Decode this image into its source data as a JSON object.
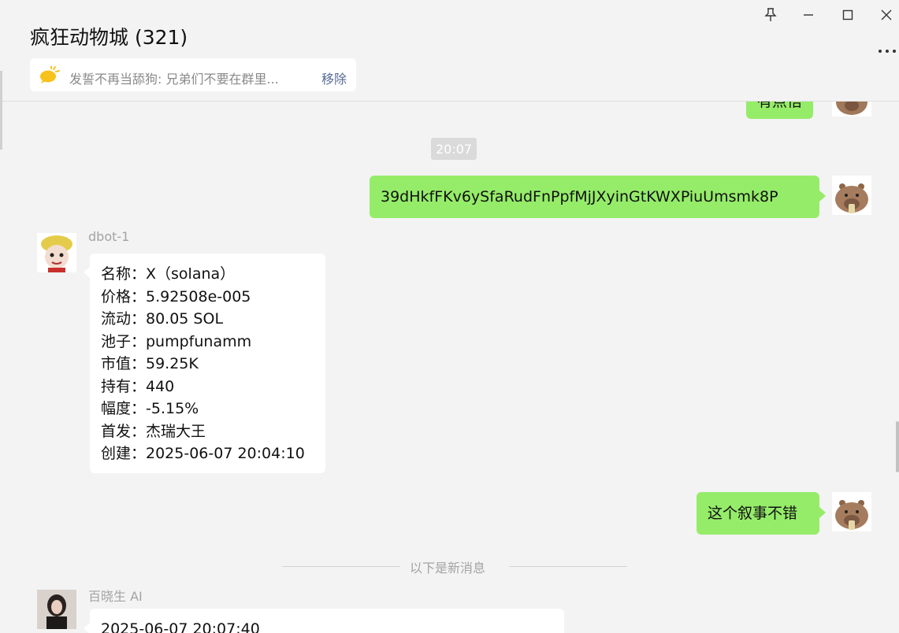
{
  "window": {
    "title": "疯狂动物城 (321)",
    "pin_icon": "pin-icon",
    "minimize_icon": "minimize-icon",
    "maximize_icon": "maximize-icon",
    "close_icon": "close-icon",
    "more_icon": "more-icon"
  },
  "pinned": {
    "icon": "speech-bubble-icon",
    "text": "发誓不再当舔狗: 兄弟们不要在群里...",
    "action": "移除"
  },
  "chat": {
    "partial_top_text": "有点悟",
    "time_divider": "20:07",
    "msg_contract": "39dHkfFKv6ySfaRudFnPpfMjJXyinGtKWXPiuUmsmk8P",
    "bot_name": "dbot-1",
    "bot_info": [
      "名称：X（solana）",
      "价格：5.92508e-005",
      "流动：80.05 SOL",
      "池子：pumpfunamm",
      "市值：59.25K",
      "持有：440",
      "幅度：-5.15%",
      "首发：杰瑞大王",
      "创建：2025-06-07 20:04:10"
    ],
    "msg_narrative": "这个叙事不错",
    "new_messages_divider": "以下是新消息",
    "ai_name": "百晓生 AI",
    "ai_partial_text": "2025-06-07 20:07:40"
  },
  "colors": {
    "self_bubble": "#95ec69",
    "other_bubble": "#ffffff",
    "background": "#f3f3f3",
    "link": "#576b95"
  }
}
